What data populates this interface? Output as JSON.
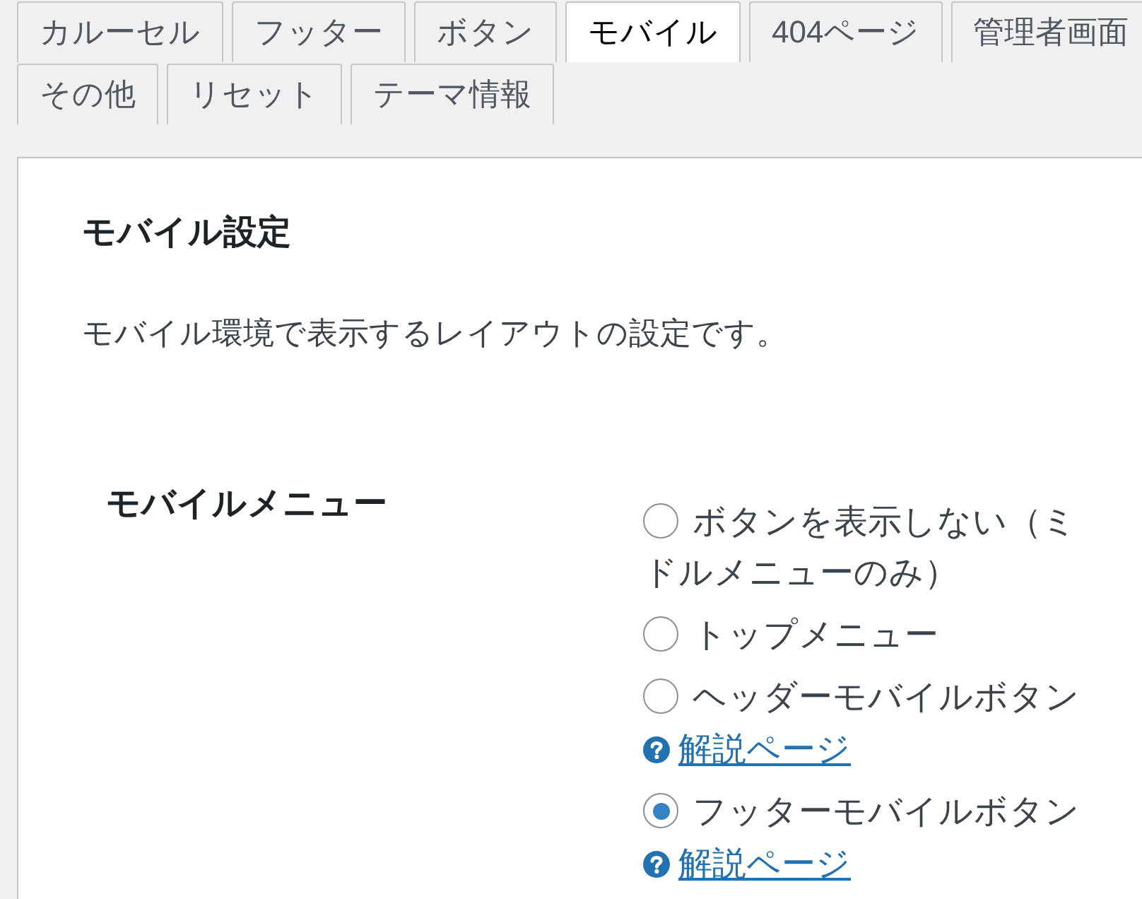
{
  "tabs": [
    {
      "label": "カルーセル",
      "selected": false
    },
    {
      "label": "フッター",
      "selected": false
    },
    {
      "label": "ボタン",
      "selected": false
    },
    {
      "label": "モバイル",
      "selected": true
    },
    {
      "label": "404ページ",
      "selected": false
    },
    {
      "label": "管理者画面",
      "selected": false
    },
    {
      "label": "その他",
      "selected": false
    },
    {
      "label": "リセット",
      "selected": false
    },
    {
      "label": "テーマ情報",
      "selected": false
    }
  ],
  "section": {
    "title": "モバイル設定",
    "description": "モバイル環境で表示するレイアウトの設定です。"
  },
  "settings": [
    {
      "label": "モバイルメニュー",
      "options": [
        {
          "label": "ボタンを表示しない（ミドルメニューのみ）",
          "selected": false
        },
        {
          "label": "トップメニュー",
          "selected": false
        },
        {
          "label": "ヘッダーモバイルボタン",
          "selected": false,
          "help_link": "解説ページ"
        },
        {
          "label": "フッターモバイルボタン",
          "selected": true,
          "help_link": "解説ページ"
        }
      ]
    }
  ]
}
